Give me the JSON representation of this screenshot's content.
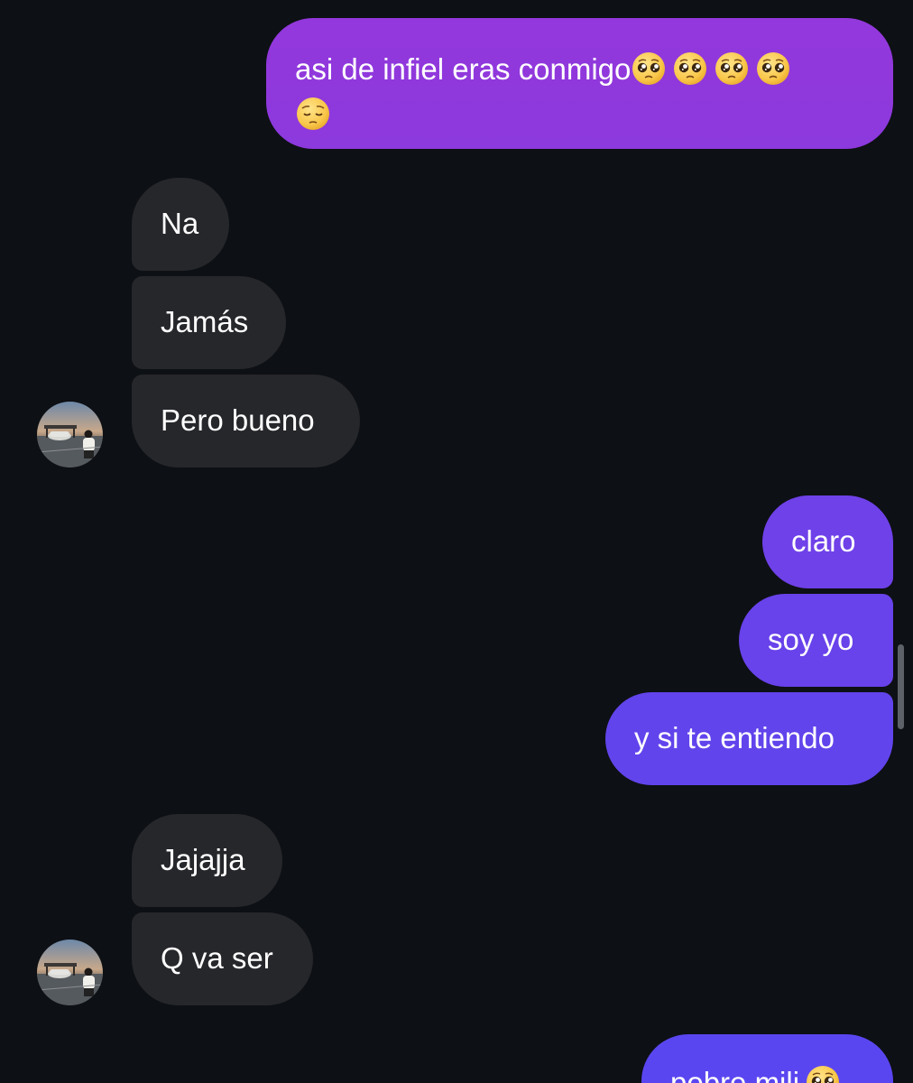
{
  "conversation": {
    "messages": [
      {
        "id": "m1",
        "sender": "me",
        "text": "asi de infiel eras conmigo",
        "emojis": [
          "pleading-face",
          "pleading-face",
          "pleading-face",
          "pleading-face",
          "pensive-face"
        ]
      },
      {
        "id": "m2",
        "sender": "them",
        "text": "Na"
      },
      {
        "id": "m3",
        "sender": "them",
        "text": "Jamás"
      },
      {
        "id": "m4",
        "sender": "them",
        "text": "Pero bueno",
        "avatar": true
      },
      {
        "id": "m5",
        "sender": "me",
        "text": "claro"
      },
      {
        "id": "m6",
        "sender": "me",
        "text": "soy yo"
      },
      {
        "id": "m7",
        "sender": "me",
        "text": "y si te entiendo"
      },
      {
        "id": "m8",
        "sender": "them",
        "text": "Jajajja"
      },
      {
        "id": "m9",
        "sender": "them",
        "text": "Q va ser",
        "avatar": true
      },
      {
        "id": "m10",
        "sender": "me",
        "text": "pobre mili",
        "emojis": [
          "pleading-face"
        ]
      }
    ]
  },
  "colors": {
    "background": "#0d1014",
    "incoming_bubble": "#26272b",
    "outgoing_gradient_top": "#9338dc",
    "outgoing_gradient_bottom": "#5a46f0",
    "text": "#ffffff",
    "scrollbar": "#5d6168"
  },
  "icons": {
    "emoji_pleading": "pleading-face",
    "emoji_pensive": "pensive-face",
    "avatar": "contact-avatar-photo"
  }
}
